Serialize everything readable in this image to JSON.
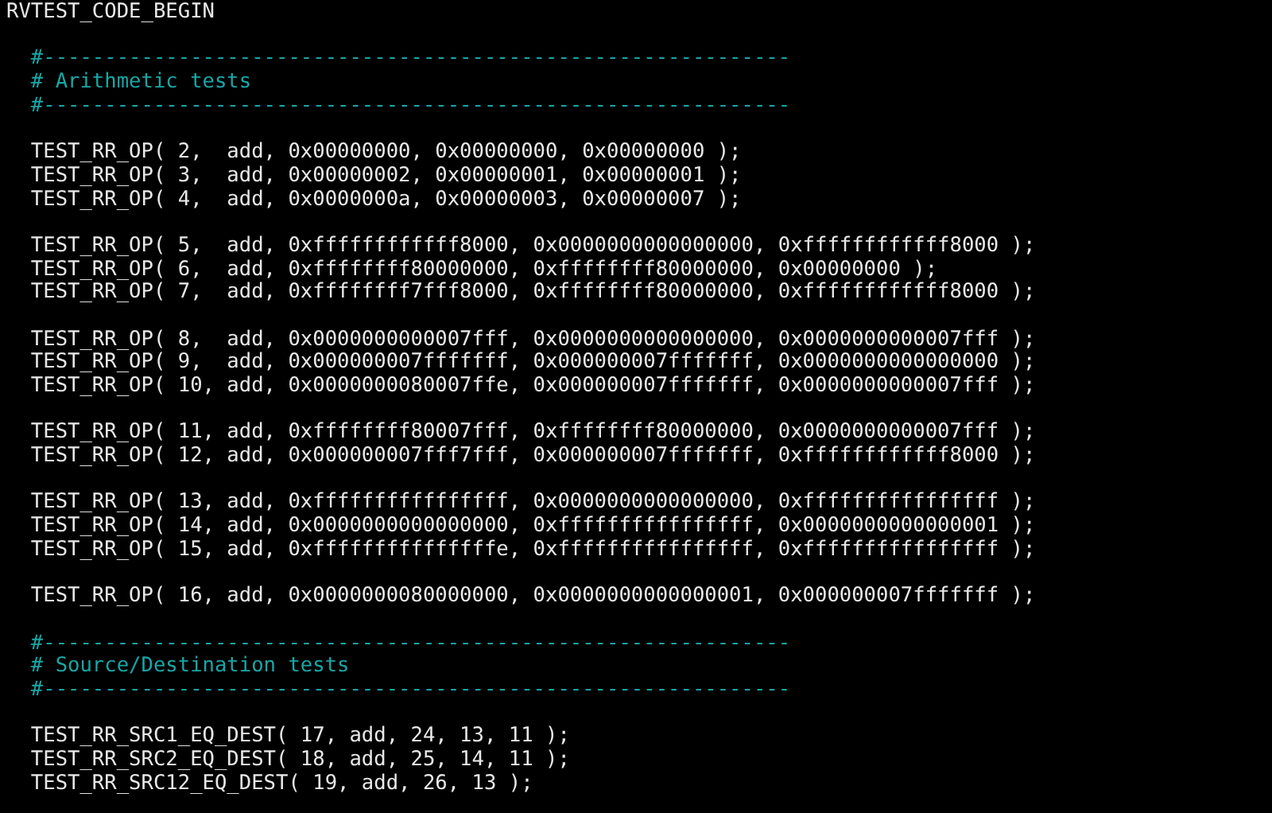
{
  "lines": [
    {
      "kind": "code",
      "text": "RVTEST_CODE_BEGIN"
    },
    {
      "kind": "blank"
    },
    {
      "kind": "comment",
      "text": "  #-------------------------------------------------------------"
    },
    {
      "kind": "comment",
      "text": "  # Arithmetic tests"
    },
    {
      "kind": "comment",
      "text": "  #-------------------------------------------------------------"
    },
    {
      "kind": "blank"
    },
    {
      "kind": "code",
      "text": "  TEST_RR_OP( 2,  add, 0x00000000, 0x00000000, 0x00000000 );"
    },
    {
      "kind": "code",
      "text": "  TEST_RR_OP( 3,  add, 0x00000002, 0x00000001, 0x00000001 );"
    },
    {
      "kind": "code",
      "text": "  TEST_RR_OP( 4,  add, 0x0000000a, 0x00000003, 0x00000007 );"
    },
    {
      "kind": "blank"
    },
    {
      "kind": "code",
      "text": "  TEST_RR_OP( 5,  add, 0xffffffffffff8000, 0x0000000000000000, 0xffffffffffff8000 );"
    },
    {
      "kind": "code",
      "text": "  TEST_RR_OP( 6,  add, 0xffffffff80000000, 0xffffffff80000000, 0x00000000 );"
    },
    {
      "kind": "code",
      "text": "  TEST_RR_OP( 7,  add, 0xffffffff7fff8000, 0xffffffff80000000, 0xffffffffffff8000 );"
    },
    {
      "kind": "blank"
    },
    {
      "kind": "code",
      "text": "  TEST_RR_OP( 8,  add, 0x0000000000007fff, 0x0000000000000000, 0x0000000000007fff );"
    },
    {
      "kind": "code",
      "text": "  TEST_RR_OP( 9,  add, 0x000000007fffffff, 0x000000007fffffff, 0x0000000000000000 );"
    },
    {
      "kind": "code",
      "text": "  TEST_RR_OP( 10, add, 0x0000000080007ffe, 0x000000007fffffff, 0x0000000000007fff );"
    },
    {
      "kind": "blank"
    },
    {
      "kind": "code",
      "text": "  TEST_RR_OP( 11, add, 0xffffffff80007fff, 0xffffffff80000000, 0x0000000000007fff );"
    },
    {
      "kind": "code",
      "text": "  TEST_RR_OP( 12, add, 0x000000007fff7fff, 0x000000007fffffff, 0xffffffffffff8000 );"
    },
    {
      "kind": "blank"
    },
    {
      "kind": "code",
      "text": "  TEST_RR_OP( 13, add, 0xffffffffffffffff, 0x0000000000000000, 0xffffffffffffffff );"
    },
    {
      "kind": "code",
      "text": "  TEST_RR_OP( 14, add, 0x0000000000000000, 0xffffffffffffffff, 0x0000000000000001 );"
    },
    {
      "kind": "code",
      "text": "  TEST_RR_OP( 15, add, 0xfffffffffffffffe, 0xffffffffffffffff, 0xffffffffffffffff );"
    },
    {
      "kind": "blank"
    },
    {
      "kind": "code",
      "text": "  TEST_RR_OP( 16, add, 0x0000000080000000, 0x0000000000000001, 0x000000007fffffff );"
    },
    {
      "kind": "blank"
    },
    {
      "kind": "comment",
      "text": "  #-------------------------------------------------------------"
    },
    {
      "kind": "comment",
      "text": "  # Source/Destination tests"
    },
    {
      "kind": "comment",
      "text": "  #-------------------------------------------------------------"
    },
    {
      "kind": "blank"
    },
    {
      "kind": "code",
      "text": "  TEST_RR_SRC1_EQ_DEST( 17, add, 24, 13, 11 );"
    },
    {
      "kind": "code",
      "text": "  TEST_RR_SRC2_EQ_DEST( 18, add, 25, 14, 11 );"
    },
    {
      "kind": "code",
      "text": "  TEST_RR_SRC12_EQ_DEST( 19, add, 26, 13 );"
    }
  ]
}
